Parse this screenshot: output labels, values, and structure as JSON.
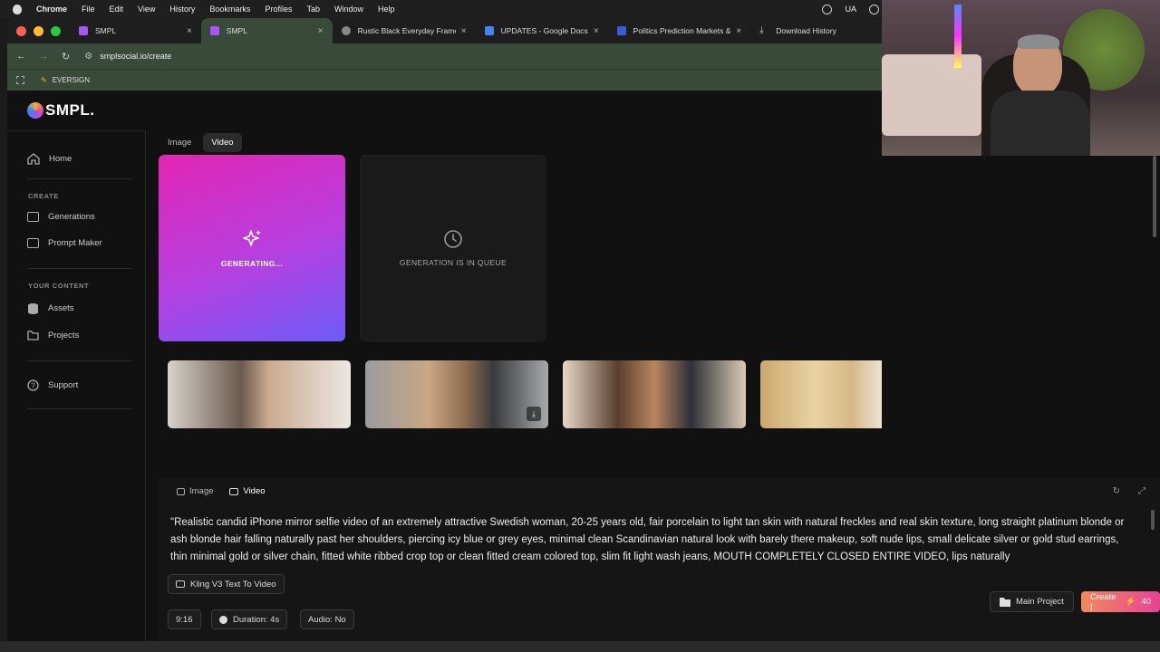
{
  "menubar": {
    "app": "Chrome",
    "items": [
      "File",
      "Edit",
      "View",
      "History",
      "Bookmarks",
      "Profiles",
      "Tab",
      "Window",
      "Help"
    ],
    "input_source": "UA"
  },
  "tabs": [
    {
      "title": "SMPL",
      "color": "#a855f7"
    },
    {
      "title": "SMPL",
      "color": "#a855f7"
    },
    {
      "title": "Rustic Black Everyday Frame",
      "color": "#888888"
    },
    {
      "title": "UPDATES - Google Docs",
      "color": "#4285f4"
    },
    {
      "title": "Politics Prediction Markets &",
      "color": "#3b5bdb"
    },
    {
      "title": "Download History",
      "color": "#cccccc"
    }
  ],
  "address": {
    "url": "smplsocial.io/create"
  },
  "bookmarks": {
    "item": "EVERSIGN"
  },
  "logo": {
    "text": "SMPL."
  },
  "sidebar": {
    "home": "Home",
    "create_heading": "CREATE",
    "generations": "Generations",
    "prompt_maker": "Prompt Maker",
    "content_heading": "YOUR CONTENT",
    "assets": "Assets",
    "projects": "Projects",
    "support": "Support"
  },
  "mode_tabs": {
    "image": "Image",
    "video": "Video",
    "active": "Video"
  },
  "cards": {
    "generating": "GENERATING...",
    "queue": "GENERATION IS IN QUEUE"
  },
  "composer": {
    "tab_image": "Image",
    "tab_video": "Video",
    "prompt": "\"Realistic candid iPhone mirror selfie video of an extremely attractive Swedish woman, 20-25 years old, fair porcelain to light tan skin with natural freckles and real skin texture, long straight platinum blonde or ash blonde hair falling naturally past her shoulders, piercing icy blue or grey eyes, minimal clean Scandinavian natural look with barely there makeup, soft nude lips, small delicate silver or gold stud earrings, thin minimal gold or silver chain, fitted white ribbed crop top or clean fitted cream colored top, slim fit light wash jeans, MOUTH COMPLETELY CLOSED ENTIRE VIDEO, lips naturally",
    "model": "Kling V3 Text To Video",
    "aspect": "9:16",
    "duration": "Duration: 4s",
    "audio": "Audio: No",
    "project": "Main Project",
    "create": "Create |",
    "credits": "40"
  },
  "colors": {
    "accent_gradient_start": "#e226b4",
    "accent_gradient_end": "#6d5cf8",
    "chrome_green": "#3a4a3a"
  }
}
